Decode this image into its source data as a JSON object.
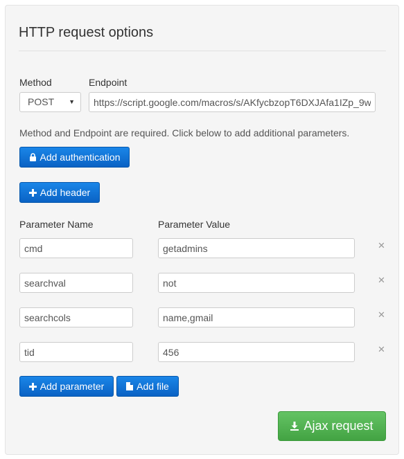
{
  "title": "HTTP request options",
  "method": {
    "label": "Method",
    "value": "POST"
  },
  "endpoint": {
    "label": "Endpoint",
    "value": "https://script.google.com/macros/s/AKfycbzopT6DXJAfa1IZp_9w"
  },
  "help_text": "Method and Endpoint are required. Click below to add additional parameters.",
  "buttons": {
    "add_authentication": "Add authentication",
    "add_header": "Add header",
    "add_parameter": "Add parameter",
    "add_file": "Add file",
    "ajax_request": "Ajax request"
  },
  "params": {
    "name_header": "Parameter Name",
    "value_header": "Parameter Value",
    "rows": [
      {
        "name": "cmd",
        "value": "getadmins"
      },
      {
        "name": "searchval",
        "value": "not"
      },
      {
        "name": "searchcols",
        "value": "name,gmail"
      },
      {
        "name": "tid",
        "value": "456"
      }
    ]
  },
  "icons": {
    "lock": "lock-icon",
    "plus": "plus-icon",
    "file": "file-icon",
    "download": "download-icon",
    "remove": "remove-icon"
  },
  "colors": {
    "primary": "#0a62c4",
    "success": "#4cae4c",
    "panel": "#f5f5f5"
  }
}
